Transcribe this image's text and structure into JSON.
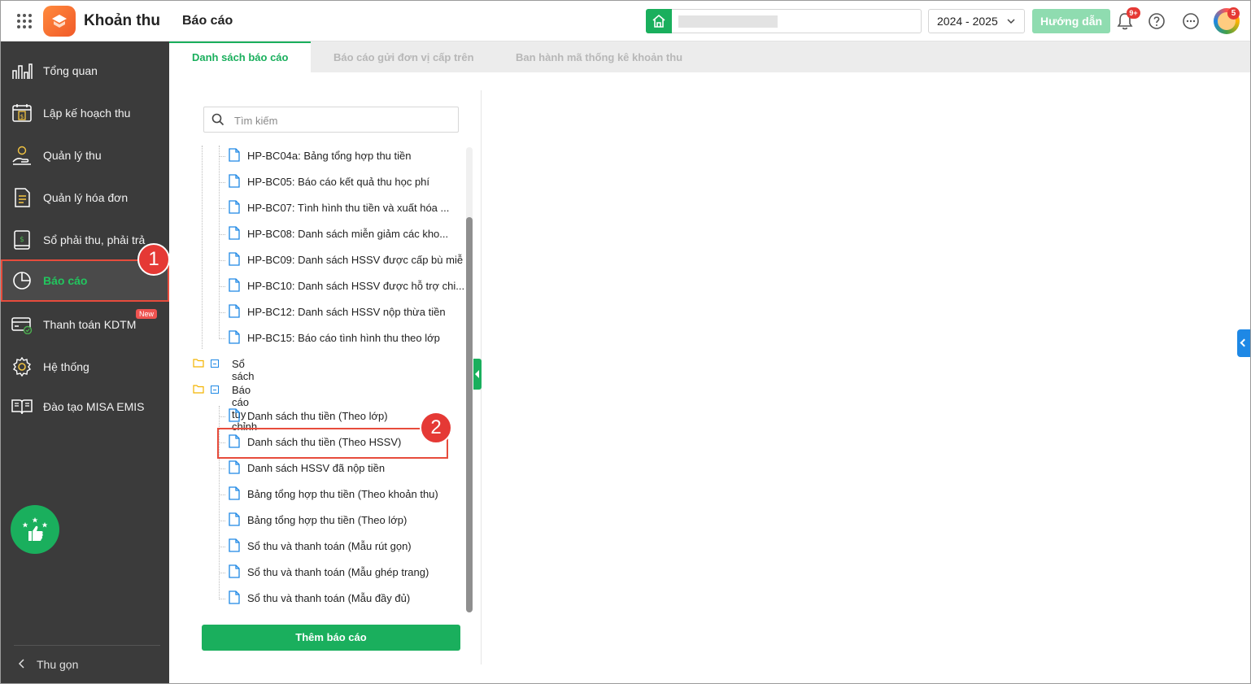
{
  "header": {
    "app_name": "Khoản thu",
    "page_title": "Báo cáo",
    "school_year": "2024 - 2025",
    "guide_label": "Hướng dẫn",
    "notification_count": "9+",
    "avatar_badge": "5"
  },
  "sidebar": {
    "items": [
      {
        "label": "Tổng quan",
        "icon": "chart-bars-icon"
      },
      {
        "label": "Lập kế hoạch thu",
        "icon": "calendar-money-icon"
      },
      {
        "label": "Quản lý thu",
        "icon": "hand-coin-icon"
      },
      {
        "label": "Quản lý hóa đơn",
        "icon": "invoice-icon"
      },
      {
        "label": "Sổ phải thu, phải trả",
        "icon": "ledger-icon"
      },
      {
        "label": "Báo cáo",
        "icon": "pie-chart-icon"
      },
      {
        "label": "Thanh toán KDTM",
        "icon": "card-payment-icon",
        "badge": "New"
      },
      {
        "label": "Hệ thống",
        "icon": "gear-icon"
      },
      {
        "label": "Đào tạo MISA EMIS",
        "icon": "open-book-icon"
      }
    ],
    "collapse_label": "Thu gọn",
    "marker_1": "1"
  },
  "tabs": [
    {
      "label": "Danh sách báo cáo"
    },
    {
      "label": "Báo cáo gửi đơn vị cấp trên"
    },
    {
      "label": "Ban hành mã thống kê khoản thu"
    }
  ],
  "search": {
    "placeholder": "Tìm kiếm"
  },
  "tree": {
    "group1_items": [
      "HP-BC04a: Bảng tổng hợp thu tiền",
      "HP-BC05: Báo cáo kết quả thu học phí",
      "HP-BC07: Tình hình thu tiền và xuất hóa ...",
      "HP-BC08: Danh sách miễn giảm các kho...",
      "HP-BC09: Danh sách HSSV được cấp bù miễ",
      "HP-BC10: Danh sách HSSV được hỗ trợ chi...",
      "HP-BC12: Danh sách HSSV nộp thừa tiền",
      "HP-BC15: Báo cáo tình hình thu theo lớp"
    ],
    "folder_so_sach": "Sổ sách",
    "folder_custom": "Báo cáo tùy chỉnh",
    "custom_items": [
      "Danh sách thu tiền (Theo lớp)",
      "Danh sách thu tiền (Theo HSSV)",
      "Danh sách HSSV đã nộp tiền",
      "Bảng tổng hợp thu tiền (Theo khoản thu)",
      "Bảng tổng hợp thu tiền (Theo lớp)",
      "Sổ thu và thanh toán (Mẫu rút gọn)",
      "Sổ thu và thanh toán (Mẫu ghép trang)",
      "Sổ thu và thanh toán (Mẫu đầy đủ)"
    ],
    "marker_2": "2"
  },
  "add_report_label": "Thêm báo cáo",
  "colors": {
    "accent": "#1aaf5d",
    "sidebar_bg": "#3b3b3b",
    "highlight": "#e74c3c"
  }
}
